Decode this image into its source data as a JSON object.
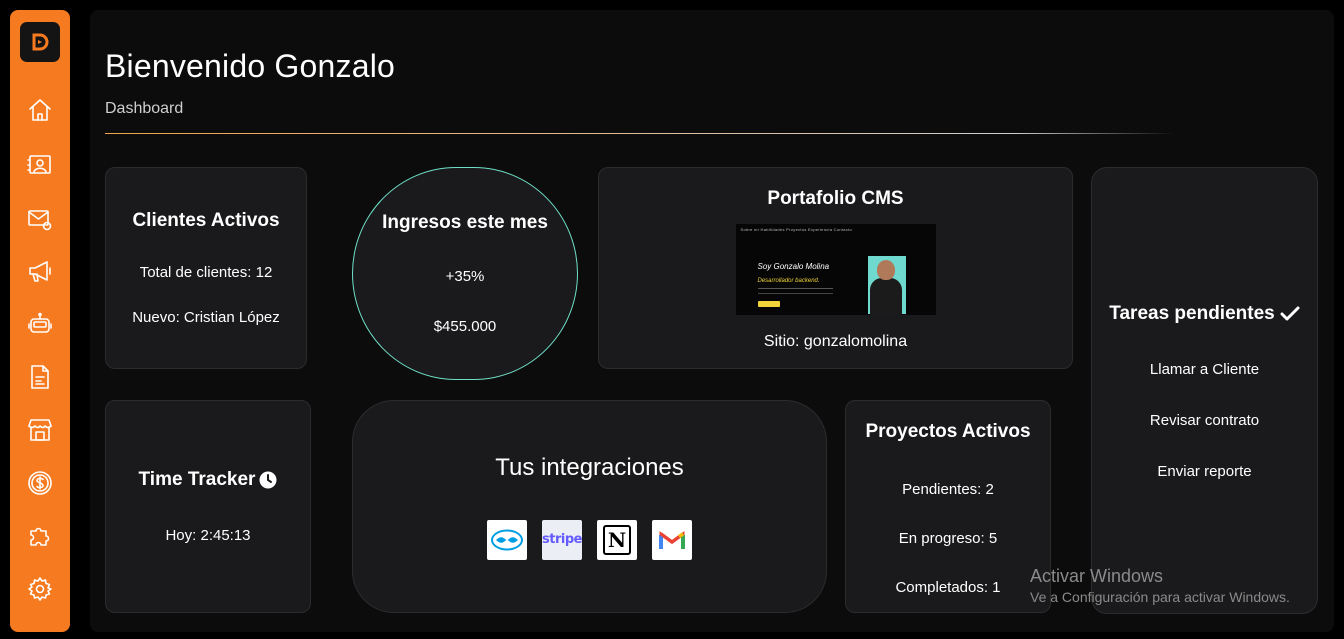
{
  "header": {
    "title": "Bienvenido Gonzalo",
    "subtitle": "Dashboard"
  },
  "sidebar": {
    "logo": "D",
    "items": [
      {
        "icon": "home-icon"
      },
      {
        "icon": "contacts-icon"
      },
      {
        "icon": "mail-icon"
      },
      {
        "icon": "megaphone-icon"
      },
      {
        "icon": "robot-icon"
      },
      {
        "icon": "document-icon"
      },
      {
        "icon": "store-icon"
      },
      {
        "icon": "dollar-icon"
      },
      {
        "icon": "puzzle-icon"
      },
      {
        "icon": "settings-icon"
      }
    ]
  },
  "clientes": {
    "title": "Clientes Activos",
    "total": "Total de clientes: 12",
    "nuevo": "Nuevo: Cristian López"
  },
  "ingresos": {
    "title": "Ingresos este mes",
    "growth": "+35%",
    "amount": "$455.000"
  },
  "portafolio": {
    "title": "Portafolio CMS",
    "preview_nav": "Sobre mí   Habilidades   Proyectos   Experiencia   Contacto",
    "preview_name": "Soy Gonzalo Molina",
    "preview_role": "Desarrollador backend.",
    "site": "Sitio: gonzalomolina"
  },
  "tareas": {
    "title": "Tareas pendientes",
    "items": [
      "Llamar a Cliente",
      "Revisar contrato",
      "Enviar reporte"
    ]
  },
  "time_tracker": {
    "title": "Time Tracker",
    "today": "Hoy: 2:45:13"
  },
  "integraciones": {
    "title": "Tus integraciones",
    "logos": [
      "mercadopago-icon",
      "stripe-icon",
      "notion-icon",
      "gmail-icon"
    ],
    "stripe_text": "stripe",
    "notion_text": "N"
  },
  "proyectos": {
    "title": "Proyectos Activos",
    "pendientes": "Pendientes: 2",
    "en_progreso": "En progreso: 5",
    "completados": "Completados: 1"
  },
  "watermark": {
    "line1": "Activar Windows",
    "line2": "Ve a Configuración para activar Windows."
  },
  "colors": {
    "sidebar": "#f57a20",
    "background": "#0c0c0c",
    "card": "#1a1a1c",
    "accent_teal": "#6fe0c8"
  }
}
